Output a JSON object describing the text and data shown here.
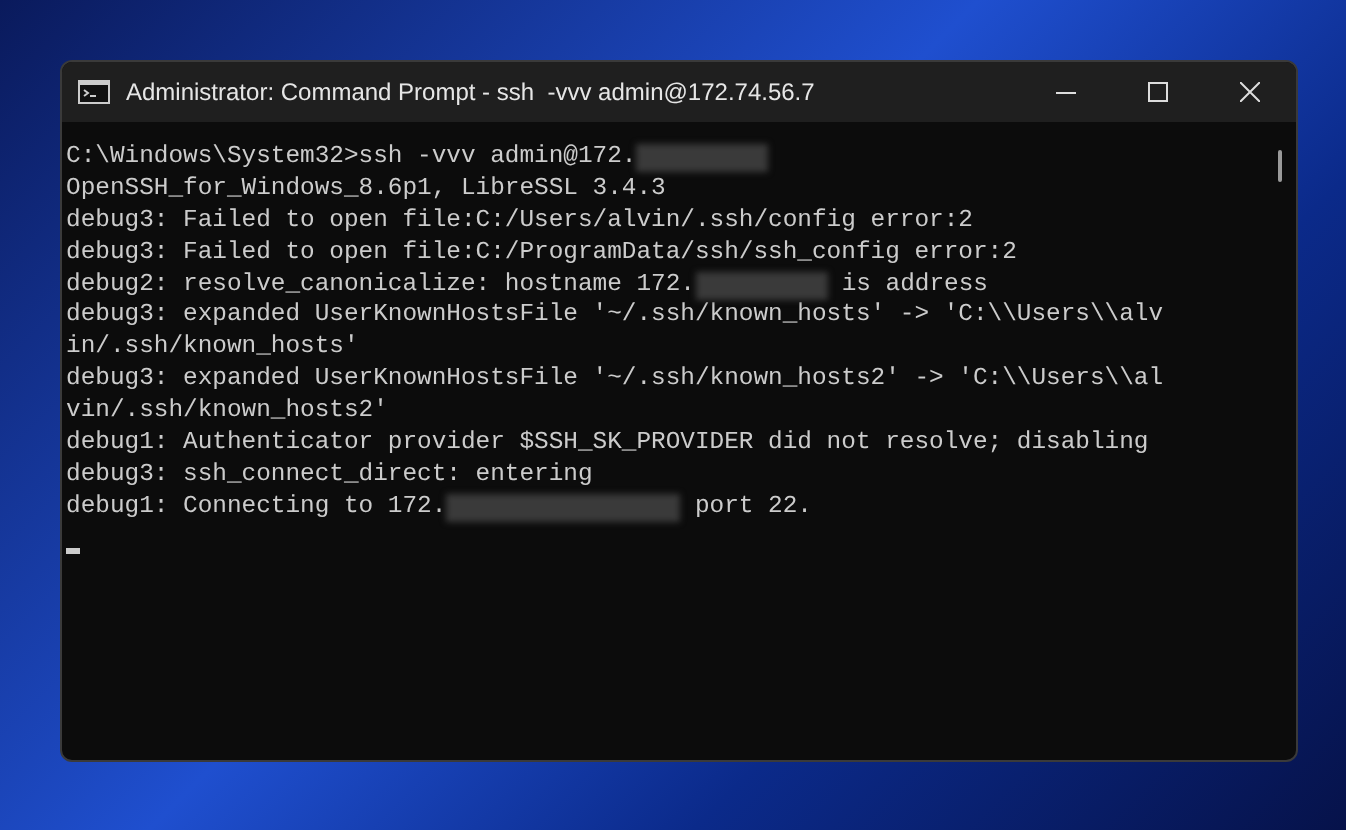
{
  "window": {
    "title": "Administrator: Command Prompt - ssh  -vvv admin@172.74.56.7"
  },
  "console": {
    "lines": [
      [
        {
          "kind": "text",
          "text": "C:\\Windows\\System32>ssh -vvv admin@172."
        },
        {
          "kind": "redacted-short"
        }
      ],
      [
        {
          "kind": "text",
          "text": "OpenSSH_for_Windows_8.6p1, LibreSSL 3.4.3"
        }
      ],
      [
        {
          "kind": "text",
          "text": "debug3: Failed to open file:C:/Users/alvin/.ssh/config error:2"
        }
      ],
      [
        {
          "kind": "text",
          "text": "debug3: Failed to open file:C:/ProgramData/ssh/ssh_config error:2"
        }
      ],
      [
        {
          "kind": "text",
          "text": "debug2: resolve_canonicalize: hostname 172."
        },
        {
          "kind": "redacted-short"
        },
        {
          "kind": "text",
          "text": " is address"
        }
      ],
      [
        {
          "kind": "text",
          "text": "debug3: expanded UserKnownHostsFile '~/.ssh/known_hosts' -> 'C:\\\\Users\\\\alv"
        }
      ],
      [
        {
          "kind": "text",
          "text": "in/.ssh/known_hosts'"
        }
      ],
      [
        {
          "kind": "text",
          "text": "debug3: expanded UserKnownHostsFile '~/.ssh/known_hosts2' -> 'C:\\\\Users\\\\al"
        }
      ],
      [
        {
          "kind": "text",
          "text": "vin/.ssh/known_hosts2'"
        }
      ],
      [
        {
          "kind": "text",
          "text": "debug1: Authenticator provider $SSH_SK_PROVIDER did not resolve; disabling"
        }
      ],
      [
        {
          "kind": "text",
          "text": "debug3: ssh_connect_direct: entering"
        }
      ],
      [
        {
          "kind": "text",
          "text": "debug1: Connecting to 172."
        },
        {
          "kind": "redacted-long"
        },
        {
          "kind": "text",
          "text": " port 22."
        }
      ]
    ]
  }
}
